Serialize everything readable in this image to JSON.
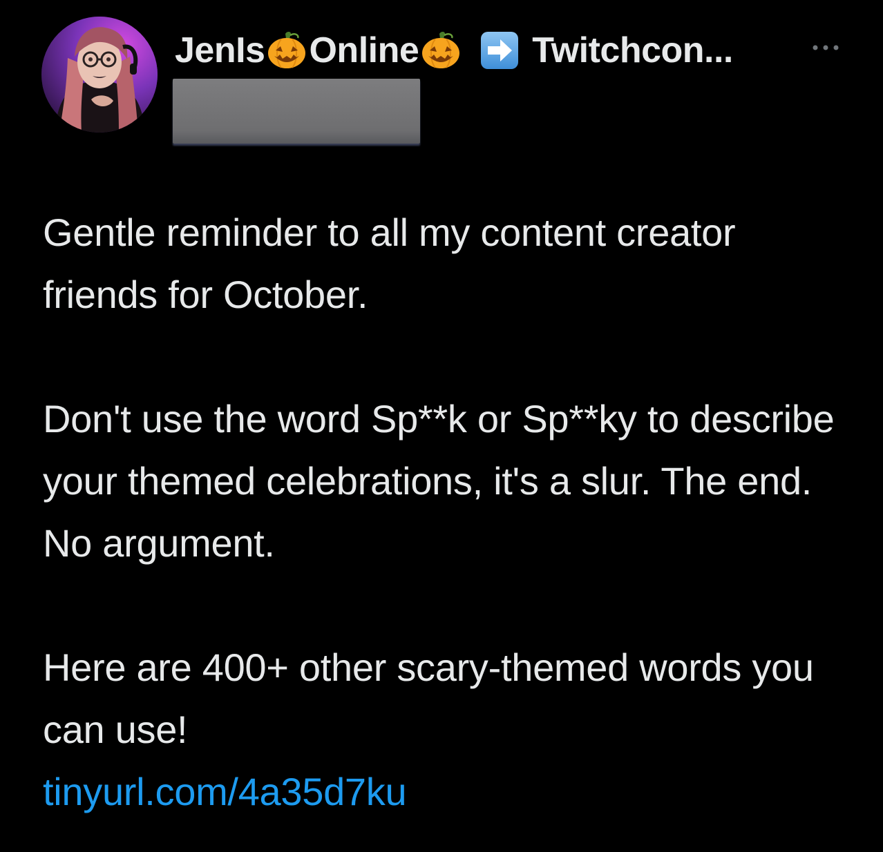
{
  "post": {
    "author": {
      "name_part1": "JenIs",
      "name_part2": "Online",
      "name_part3": "Twitchcon...",
      "handle_redacted": true
    },
    "icons": {
      "pumpkin": "jack-o-lantern-icon",
      "arrow": "right-arrow-icon",
      "more": "more-options-icon"
    },
    "paragraphs": [
      "Gentle reminder to all my content creator friends for October.",
      "Don't use the word Sp**k or Sp**ky to describe your themed celebrations, it's a slur. The end. No argument.",
      "Here are 400+ other scary-themed words you can use!"
    ],
    "link": "tinyurl.com/4a35d7ku"
  },
  "colors": {
    "background": "#000000",
    "text": "#e7e9ea",
    "link": "#1d9bf0",
    "redaction": "#747476"
  }
}
